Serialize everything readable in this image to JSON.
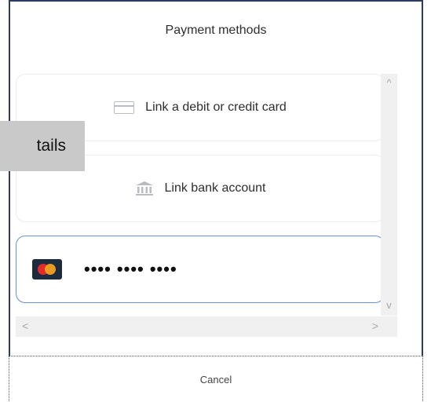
{
  "dialog": {
    "title": "Payment methods"
  },
  "options": {
    "card": {
      "label": "Link a debit or credit card",
      "icon": "credit-card-icon"
    },
    "bank": {
      "label": "Link bank account",
      "icon": "bank-icon"
    },
    "saved_card": {
      "brand_icon": "mastercard-icon",
      "masked_number": "•••• •••• ••••"
    }
  },
  "scrollbar": {
    "up_arrow": "^",
    "down_arrow": "v",
    "left_arrow": "<",
    "right_arrow": ">"
  },
  "cancel_label": "Cancel",
  "overlay_text": "tails",
  "colors": {
    "dialog_border": "#2d3a64",
    "selected_border": "#6a8fd4",
    "scrollbar": "#f0f0f0",
    "overlay_bg": "#c9c9c9"
  }
}
